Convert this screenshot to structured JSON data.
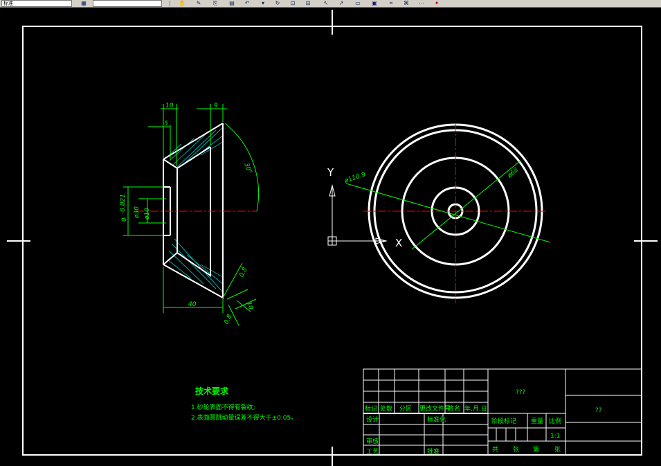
{
  "toolbar": {
    "layer_value": "标准",
    "style_value": ""
  },
  "drawing": {
    "dimensions": {
      "top_10": "10",
      "top_9": "9",
      "dim_5": "5",
      "angle": "30°",
      "dia_30": "ø30",
      "tol_30": "-0.021",
      "tol_30_zero": "0",
      "dia_10": "ø10",
      "bottom_40": "40",
      "dim_08a": "0.8",
      "dim_10b": "10",
      "dim_08b": "0.8",
      "dia_1109": "ø110.9",
      "dia_68": "ø68"
    },
    "ucs": {
      "y_label": "Y",
      "x_label": "X"
    },
    "tech_req": {
      "title": "技术要求",
      "line1": "1.砂轮表面不得有裂纹;",
      "line2": "2.表面圆跳动量误差不得大于±0.05。"
    }
  },
  "title_block": {
    "part_name": "???",
    "company": "??",
    "row_labels": [
      "标记",
      "处数",
      "分区",
      "更改文件号",
      "签名",
      "年.月.日"
    ],
    "design": "设计",
    "standardize": "标准化",
    "review": "审核",
    "process": "工艺",
    "approve": "批准",
    "stage_mark": "阶段标记",
    "weight": "重量",
    "scale": "比例",
    "scale_value": "1:1",
    "total": "共",
    "sheets": "张",
    "page": "第",
    "sheet_suffix": "张"
  }
}
